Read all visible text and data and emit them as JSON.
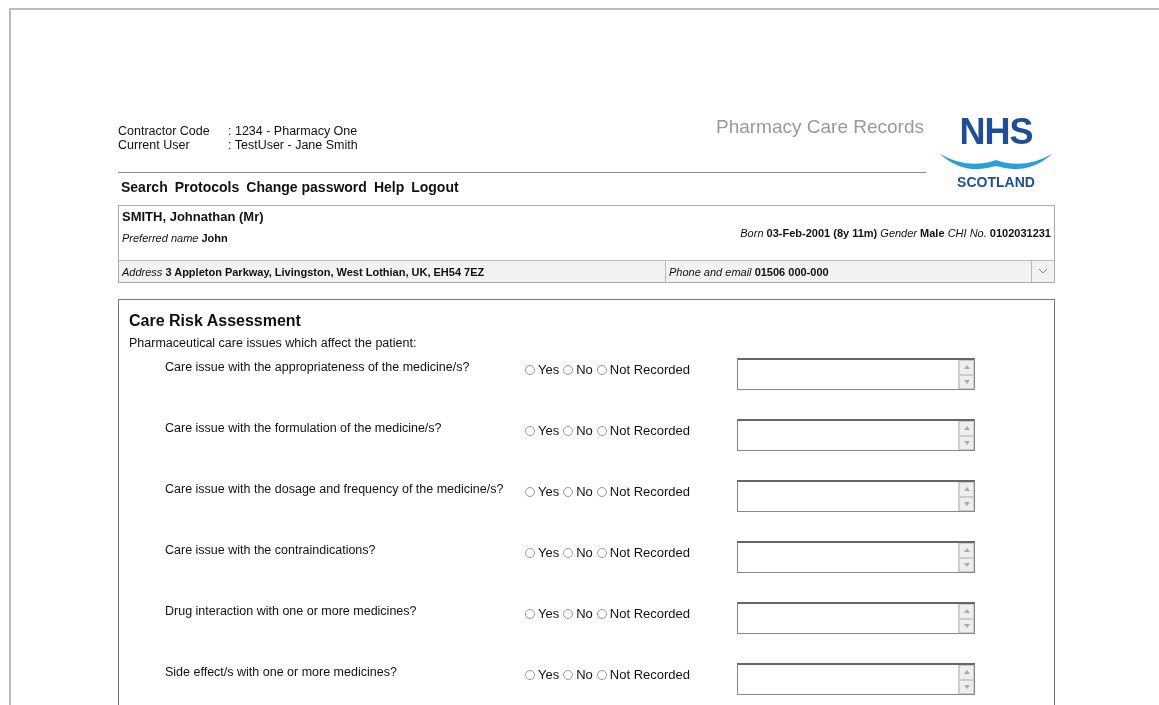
{
  "header": {
    "fields": [
      {
        "label": "Contractor Code",
        "value": ": 1234 - Pharmacy One"
      },
      {
        "label": "Current User",
        "value": ": TestUser - Jane Smith"
      }
    ],
    "app_title": "Pharmacy Care Records",
    "logo": {
      "main": "NHS",
      "sub": "SCOTLAND"
    }
  },
  "nav": [
    "Search",
    "Protocols",
    "Change password",
    "Help",
    "Logout"
  ],
  "patient": {
    "name": "SMITH, Johnathan (Mr)",
    "preferred_label": "Preferred name",
    "preferred": "John",
    "born_label": "Born",
    "born": "03-Feb-2001",
    "age": "(8y 11m)",
    "gender_label": "Gender",
    "gender": "Male",
    "chi_label": "CHI No.",
    "chi": "0102031231",
    "address_label": "Address",
    "address": "3 Appleton Parkway, Livingston, West Lothian, UK, EH54 7EZ",
    "phone_label": "Phone and email",
    "phone": "01506 000-000"
  },
  "assessment": {
    "title": "Care Risk Assessment",
    "intro": "Pharmaceutical care issues which affect the patient:",
    "questions": [
      {
        "text": "Care issue with the appropriateness of the medicine/s?",
        "options": [
          {
            "label": "Yes",
            "selected": false
          },
          {
            "label": "No",
            "selected": false
          },
          {
            "label": "Not Recorded",
            "selected": false
          }
        ]
      },
      {
        "text": "Care issue with the formulation of the medicine/s?",
        "options": [
          {
            "label": "Yes",
            "selected": false
          },
          {
            "label": "No",
            "selected": false
          },
          {
            "label": "Not Recorded",
            "selected": false
          }
        ]
      },
      {
        "text": "Care issue with the dosage and frequency of the medicine/s?",
        "options": [
          {
            "label": "Yes",
            "selected": false
          },
          {
            "label": "No",
            "selected": false
          },
          {
            "label": "Not Recorded",
            "selected": false
          }
        ]
      },
      {
        "text": "Care issue with the contraindications?",
        "options": [
          {
            "label": "Yes",
            "selected": false
          },
          {
            "label": "No",
            "selected": false
          },
          {
            "label": "Not Recorded",
            "selected": false
          }
        ]
      },
      {
        "text": "Drug interaction with one or more medicines?",
        "options": [
          {
            "label": "Yes",
            "selected": false
          },
          {
            "label": "No",
            "selected": false
          },
          {
            "label": "Not Recorded",
            "selected": false
          }
        ]
      },
      {
        "text": "Side effect/s with one or more medicines?",
        "options": [
          {
            "label": "Yes",
            "selected": false
          },
          {
            "label": "No",
            "selected": false
          },
          {
            "label": "Not Recorded",
            "selected": false
          }
        ]
      }
    ]
  }
}
